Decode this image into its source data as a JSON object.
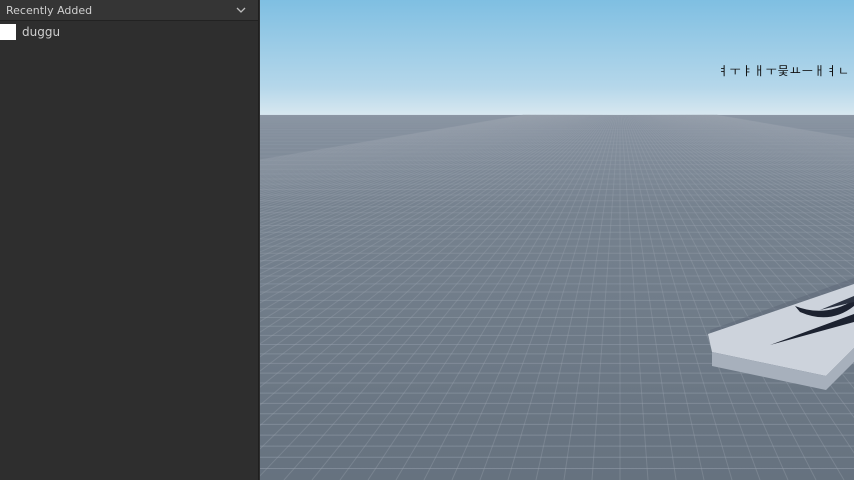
{
  "panel": {
    "title": "Recently Added",
    "items": [
      {
        "label": "duggu"
      }
    ]
  },
  "viewport": {
    "overlay_text": "ㅕㅜㅑㅐㅜ뭊ㅛㅡㅐㅕㄴ"
  },
  "colors": {
    "panel_bg": "#2e2e2e",
    "sky_top": "#86c2e3",
    "sky_horizon": "#d6e6ee",
    "ground": "#6b7889"
  }
}
